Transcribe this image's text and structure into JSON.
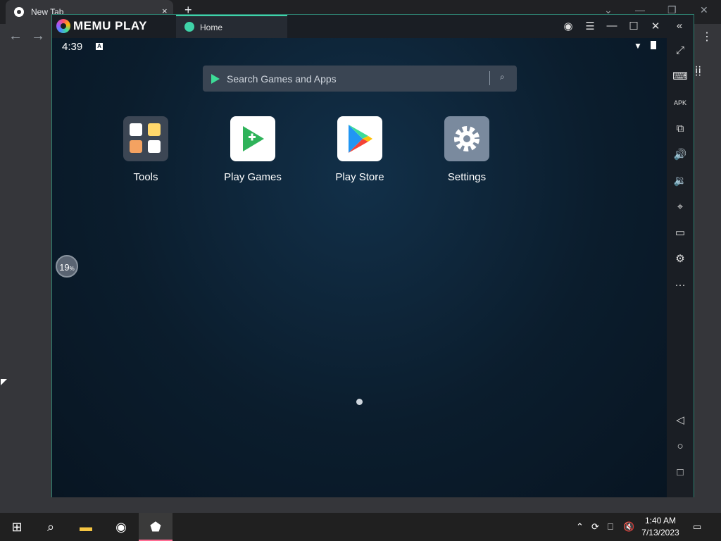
{
  "browser": {
    "tab_title": "New Tab",
    "tab_close": "×",
    "new_tab": "+"
  },
  "memu": {
    "logo_text": "MEMU PLAY",
    "home_tab": "Home",
    "status_time": "4:39",
    "status_badge": "A",
    "search_placeholder": "Search Games and Apps",
    "loader_value": "19",
    "loader_unit": "%",
    "apps": [
      {
        "label": "Tools",
        "icon": "tools-folder-icon"
      },
      {
        "label": "Play Games",
        "icon": "play-games-icon"
      },
      {
        "label": "Play Store",
        "icon": "play-store-icon"
      },
      {
        "label": "Settings",
        "icon": "settings-gear-icon"
      }
    ],
    "side_toolbar": [
      {
        "name": "fullscreen",
        "icon": "fullscreen-icon"
      },
      {
        "name": "keyboard",
        "icon": "keyboard-icon"
      },
      {
        "name": "apk",
        "icon": "apk-icon"
      },
      {
        "name": "multi-window",
        "icon": "multi-window-icon"
      },
      {
        "name": "volume-up",
        "icon": "volume-up-icon"
      },
      {
        "name": "volume-down",
        "icon": "volume-down-icon"
      },
      {
        "name": "location",
        "icon": "location-icon"
      },
      {
        "name": "folder",
        "icon": "folder-icon"
      },
      {
        "name": "settings",
        "icon": "gear-icon"
      },
      {
        "name": "more",
        "icon": "more-icon"
      },
      {
        "name": "back",
        "icon": "back-icon"
      },
      {
        "name": "home",
        "icon": "home-icon"
      },
      {
        "name": "recents",
        "icon": "recents-icon"
      }
    ]
  },
  "taskbar": {
    "time": "1:40 AM",
    "date": "7/13/2023"
  }
}
